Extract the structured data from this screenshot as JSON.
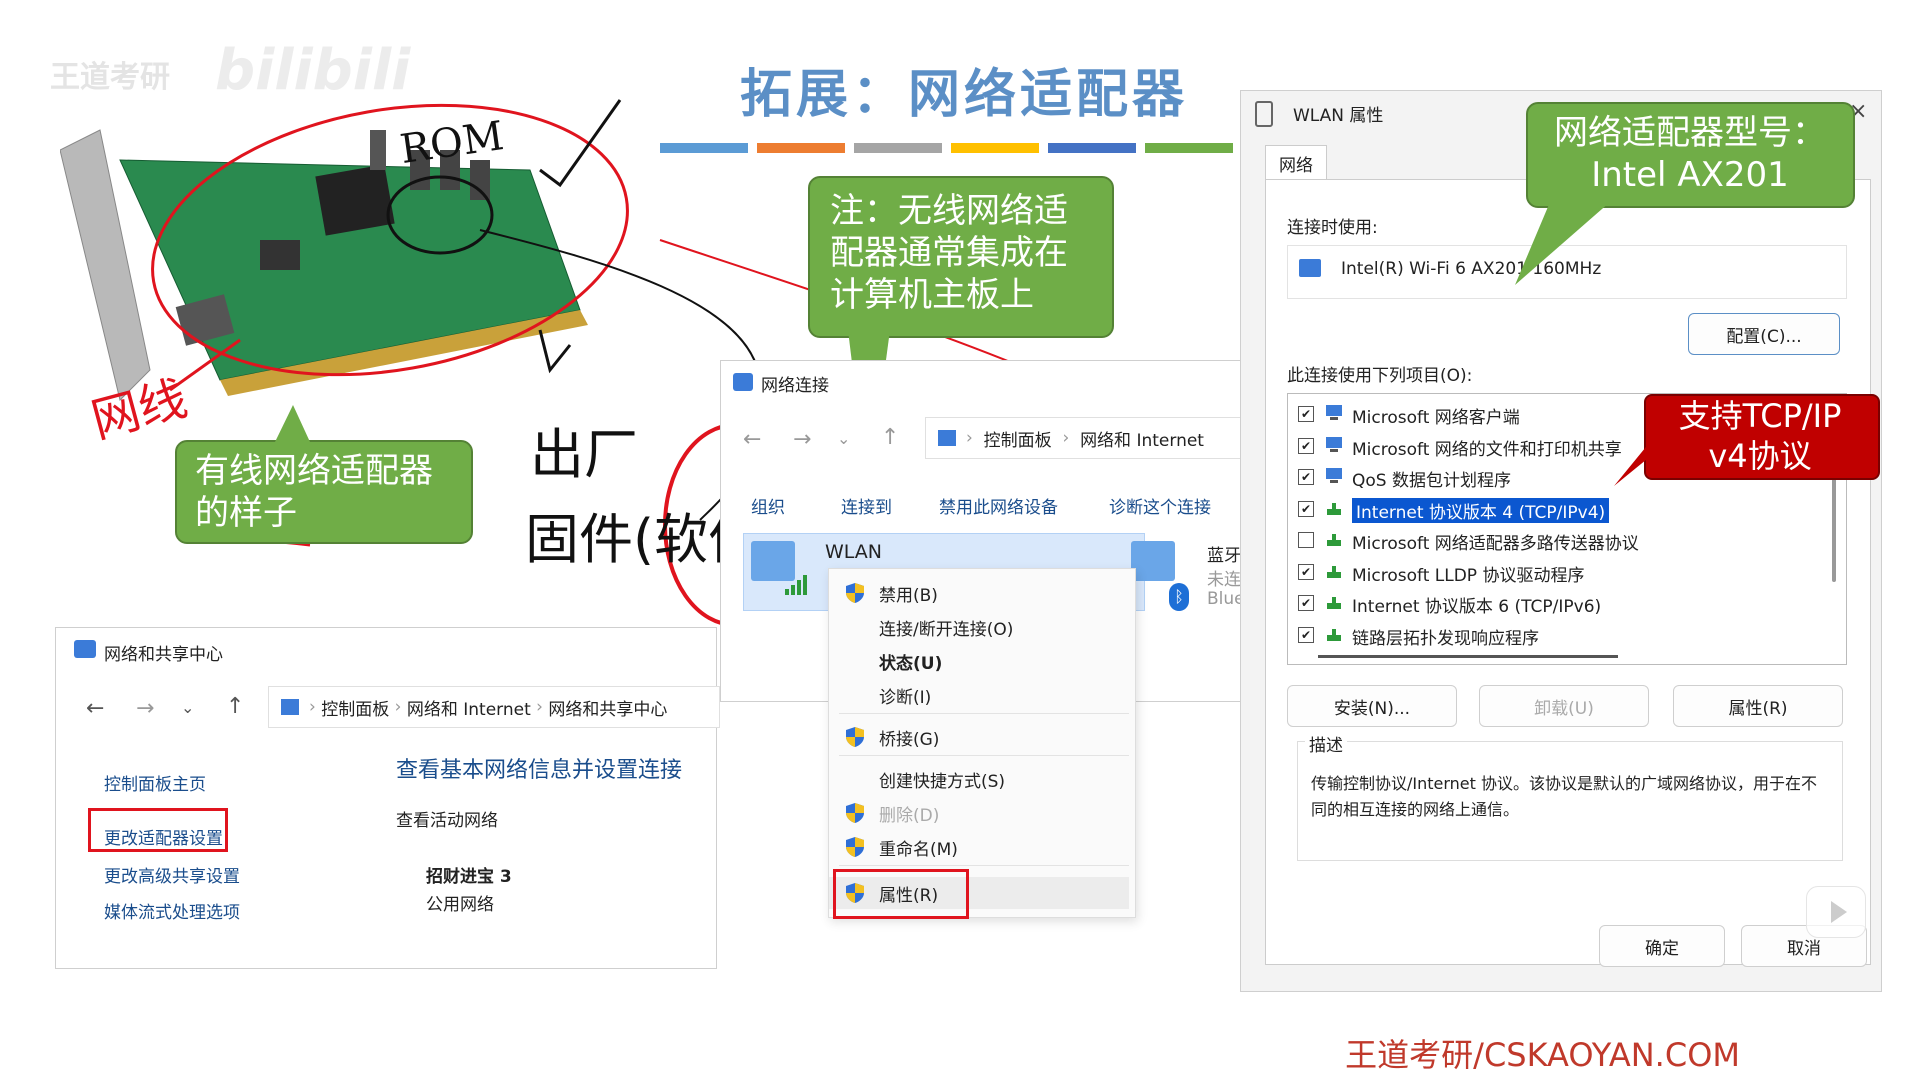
{
  "slide": {
    "title": "拓展：网络适配器",
    "watermark": "王道考研",
    "bilibili": "bilibili",
    "footer": "王道考研/CSKAOYAN.COM",
    "bar_colors": [
      "#5b9bd5",
      "#ed7d31",
      "#a5a5a5",
      "#ffc000",
      "#4472c4",
      "#70ad47"
    ]
  },
  "callouts": {
    "wired": "有线网络适配器\n的样子",
    "wireless_note": "注：无线网络适\n配器通常集成在\n计算机主板上",
    "model": "网络适配器型号：\nIntel AX201",
    "tcpip": "支持TCP/IP\nv4协议"
  },
  "handwriting": {
    "rom": "ROM",
    "cable": "网线",
    "factory": "出厂",
    "firmware": "固件(软件)"
  },
  "sharing_center": {
    "title": "网络和共享中心",
    "breadcrumb": [
      "控制面板",
      "网络和 Internet",
      "网络和共享中心"
    ],
    "left_links": [
      "控制面板主页",
      "更改适配器设置",
      "更改高级共享设置",
      "媒体流式处理选项"
    ],
    "heading": "查看基本网络信息并设置连接",
    "active_networks": "查看活动网络",
    "network_name": "招财进宝 3",
    "network_type": "公用网络"
  },
  "connections": {
    "title": "网络连接",
    "breadcrumb": [
      "控制面板",
      "网络和 Internet"
    ],
    "toolbar": [
      "组织",
      "连接到",
      "禁用此网络设备",
      "诊断这个连接"
    ],
    "adapter": "WLAN",
    "bluetooth": "蓝牙",
    "bluetooth_status": "未连",
    "bluetooth_short": "Blue"
  },
  "context_menu": {
    "items": [
      "禁用(B)",
      "连接/断开连接(O)",
      "状态(U)",
      "诊断(I)",
      "桥接(G)",
      "创建快捷方式(S)",
      "删除(D)",
      "重命名(M)",
      "属性(R)"
    ]
  },
  "properties": {
    "title": "WLAN 属性",
    "tab": "网络",
    "connect_using": "连接时使用:",
    "adapter": "Intel(R) Wi-Fi 6 AX201 160MHz",
    "configure": "配置(C)...",
    "items_label": "此连接使用下列项目(O):",
    "items": [
      {
        "label": "Microsoft 网络客户端",
        "checked": true
      },
      {
        "label": "Microsoft 网络的文件和打印机共享",
        "checked": true
      },
      {
        "label": "QoS 数据包计划程序",
        "checked": true
      },
      {
        "label": "Internet 协议版本 4 (TCP/IPv4)",
        "checked": true
      },
      {
        "label": "Microsoft 网络适配器多路传送器协议",
        "checked": false
      },
      {
        "label": "Microsoft LLDP 协议驱动程序",
        "checked": true
      },
      {
        "label": "Internet 协议版本 6 (TCP/IPv6)",
        "checked": true
      },
      {
        "label": "链路层拓扑发现响应程序",
        "checked": true
      }
    ],
    "install": "安装(N)...",
    "uninstall": "卸载(U)",
    "props": "属性(R)",
    "desc_label": "描述",
    "desc": "传输控制协议/Internet 协议。该协议是默认的广域网络协议，用于在不同的相互连接的网络上通信。",
    "ok": "确定",
    "cancel": "取消"
  }
}
